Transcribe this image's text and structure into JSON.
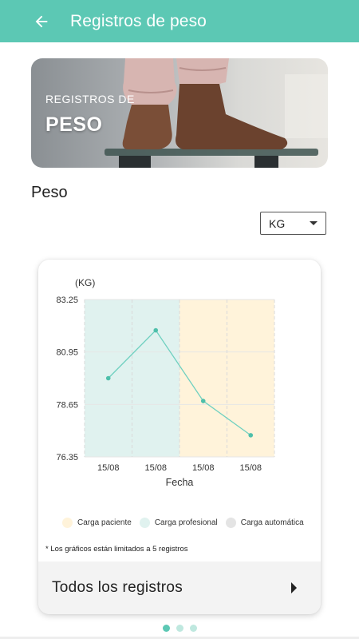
{
  "appbar": {
    "title": "Registros de peso",
    "back_icon": "arrow-left-icon"
  },
  "banner": {
    "line1": "REGISTROS DE",
    "line2": "PESO"
  },
  "section": {
    "title": "Peso"
  },
  "unit_select": {
    "value": "KG"
  },
  "colors": {
    "primary": "#5cc8b4",
    "series_line": "#6fd0c0",
    "band_professional": "#e0f2ef",
    "band_patient": "#fff3da",
    "legend_auto": "#e4e4e4"
  },
  "chart_data": {
    "type": "line",
    "ylabel": "(KG)",
    "xlabel": "Fecha",
    "categories": [
      "15/08",
      "15/08",
      "15/08",
      "15/08"
    ],
    "values": [
      79.8,
      81.9,
      78.8,
      77.3
    ],
    "yticks": [
      "83.25",
      "80.95",
      "78.65",
      "76.35"
    ],
    "ylim": [
      76.35,
      83.25
    ],
    "grid": true,
    "bands": [
      {
        "type": "Carga profesional",
        "from_index": 0,
        "to_index": 1
      },
      {
        "type": "Carga paciente",
        "from_index": 2,
        "to_index": 3
      }
    ],
    "legend": [
      {
        "label": "Carga paciente",
        "color": "#fff3da"
      },
      {
        "label": "Carga profesional",
        "color": "#e0f2ef"
      },
      {
        "label": "Carga automática",
        "color": "#e4e4e4"
      }
    ]
  },
  "footnote": "* Los gráficos están limitados a 5 registros",
  "all_records": {
    "label": "Todos los registros"
  },
  "pager": {
    "count": 3,
    "active": 0
  }
}
